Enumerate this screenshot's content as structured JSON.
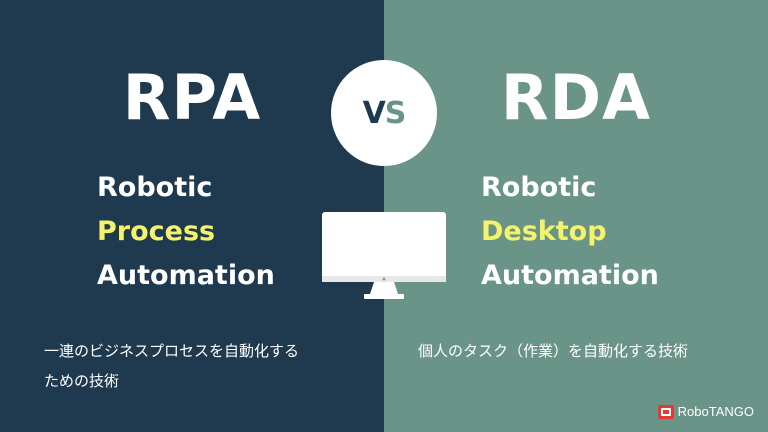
{
  "left": {
    "acronym": "RPA",
    "words": [
      "Robotic",
      "Process",
      "Automation"
    ],
    "description": [
      "一連のビジネスプロセスを自動化する",
      "ための技術"
    ]
  },
  "right": {
    "acronym": "RDA",
    "words": [
      "Robotic",
      "Desktop",
      "Automation"
    ],
    "description": [
      "個人のタスク（作業）を自動化する技術"
    ]
  },
  "vs": {
    "v": "V",
    "s": "S"
  },
  "icons": {
    "center": "monitor-icon",
    "brand": "robotango-logo-icon"
  },
  "brand": {
    "name": "RoboTANGO"
  },
  "colors": {
    "left_bg": "#1f3a4f",
    "right_bg": "#6a9488",
    "highlight": "#f4f36a",
    "text": "#ffffff",
    "brand_accent": "#e53935"
  }
}
